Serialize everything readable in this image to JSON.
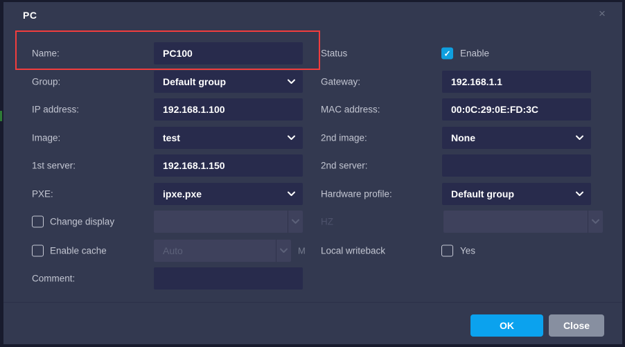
{
  "dialog": {
    "title": "PC"
  },
  "icons": {
    "close": "×",
    "check": "✓"
  },
  "left_rows": [
    {
      "label": "Name:",
      "value": "PC100"
    },
    {
      "label": "Group:",
      "value": "Default group"
    },
    {
      "label": "IP address:",
      "value": "192.168.1.100"
    },
    {
      "label": "Image:",
      "value": "test"
    },
    {
      "label": "1st server:",
      "value": "192.168.1.150"
    },
    {
      "label": "PXE:",
      "value": "ipxe.pxe"
    },
    {
      "label": "Change display",
      "value": "",
      "checked": false
    },
    {
      "label": "Enable cache",
      "value": "Auto",
      "suffix": "M",
      "checked": false
    },
    {
      "label": "Comment:",
      "value": ""
    }
  ],
  "right_rows": [
    {
      "label": "Status",
      "checkbox_label": "Enable",
      "checked": true
    },
    {
      "label": "Gateway:",
      "value": "192.168.1.1"
    },
    {
      "label": "MAC address:",
      "value": "00:0C:29:0E:FD:3C"
    },
    {
      "label": "2nd image:",
      "value": "None"
    },
    {
      "label": "2nd server:",
      "value": ""
    },
    {
      "label": "Hardware profile:",
      "value": "Default group"
    },
    {
      "label": "HZ",
      "value": ""
    },
    {
      "label": "Local writeback",
      "checkbox_label": "Yes",
      "checked": false
    }
  ],
  "footer": {
    "ok_label": "OK",
    "close_label": "Close"
  },
  "colors": {
    "accent_blue": "#0ba2ee",
    "checkbox_blue": "#0f9fdf",
    "highlight_red": "#f23d3d",
    "close_button_gray": "#878fa0",
    "dialog_bg": "#333950",
    "input_bg": "#282b4c"
  }
}
